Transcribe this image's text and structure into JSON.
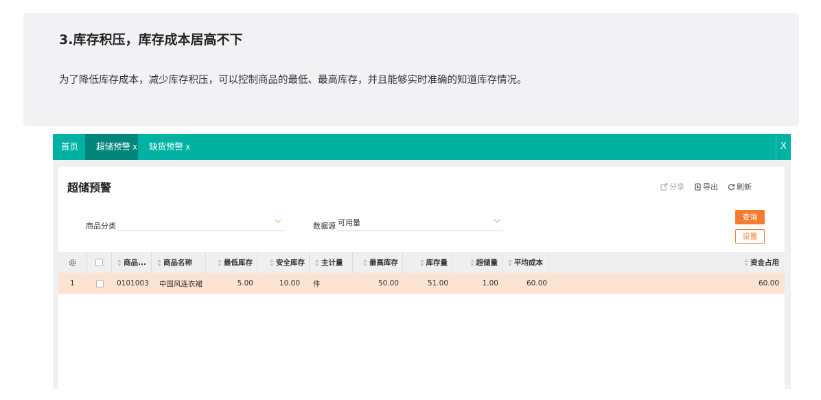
{
  "feature": {
    "title": "3.库存积压，库存成本居高不下",
    "description": "为了降低库存成本，减少库存积压，可以控制商品的最低、最高库存，并且能够实时准确的知道库存情况。"
  },
  "tabs": {
    "home": "首页",
    "active": "超储预警",
    "active_close": "x",
    "third": "缺货预警",
    "third_close": "x",
    "window_close": "X"
  },
  "page": {
    "title": "超储预警",
    "toolbar": {
      "share": "分享",
      "export": "导出",
      "refresh": "刷新"
    }
  },
  "filters": {
    "category_label": "商品分类",
    "category_value": "",
    "source_label": "数据源",
    "source_value": "可用量"
  },
  "buttons": {
    "query": "查询",
    "settings": "设置"
  },
  "table": {
    "headers": {
      "code": "商品...",
      "name": "商品名称",
      "min_stock": "最低库存",
      "safe_stock": "安全库存",
      "unit": "主计量",
      "max_stock": "最高库存",
      "stock": "库存量",
      "over": "超储量",
      "avg_cost": "平均成本",
      "capital": "资金占用"
    },
    "rows": [
      {
        "index": "1",
        "code": "0101003",
        "name": "中国风连衣裙",
        "min_stock": "5.00",
        "safe_stock": "10.00",
        "unit": "件",
        "max_stock": "50.00",
        "stock": "51.00",
        "over": "1.00",
        "avg_cost": "60.00",
        "capital": "60.00"
      }
    ]
  },
  "colors": {
    "accent": "#00b2a2",
    "accent_dark": "#00857a",
    "button": "#f47b2f",
    "row_highlight": "#fde3d2"
  }
}
